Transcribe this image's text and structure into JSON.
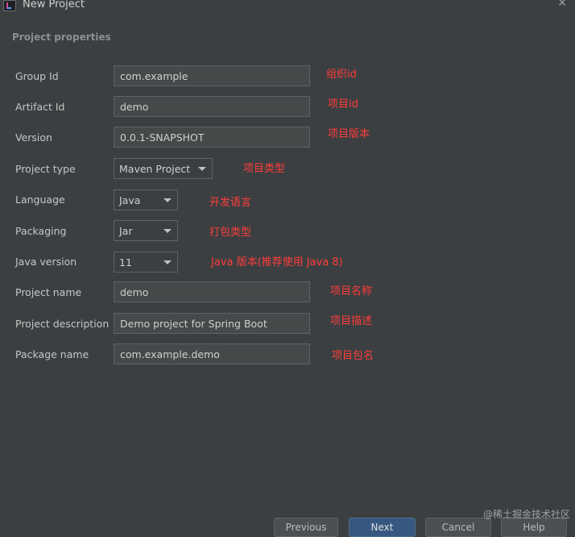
{
  "window": {
    "title": "New Project"
  },
  "section_title": "Project properties",
  "fields": {
    "group_id": {
      "label": "Group Id",
      "value": "com.example",
      "note": "组织id"
    },
    "artifact_id": {
      "label": "Artifact Id",
      "value": "demo",
      "note": "项目id"
    },
    "version": {
      "label": "Version",
      "value": "0.0.1-SNAPSHOT",
      "note": "项目版本"
    },
    "project_type": {
      "label": "Project type",
      "value": "Maven Project",
      "note": "项目类型"
    },
    "language": {
      "label": "Language",
      "value": "Java",
      "note": "开发语言"
    },
    "packaging": {
      "label": "Packaging",
      "value": "Jar",
      "note": "打包类型"
    },
    "java_version": {
      "label": "Java version",
      "value": "11",
      "note": "Java 版本(推荐使用 Java 8)"
    },
    "project_name": {
      "label": "Project name",
      "value": "demo",
      "note": "项目名称"
    },
    "project_description": {
      "label": "Project description",
      "value": "Demo project for Spring Boot",
      "note": "项目描述"
    },
    "package_name": {
      "label": "Package name",
      "value": "com.example.demo",
      "note": "项目包名"
    }
  },
  "buttons": {
    "previous": "Previous",
    "next": "Next",
    "cancel": "Cancel",
    "help": "Help"
  },
  "watermark": "@稀土掘金技术社区",
  "colors": {
    "background": "#3c3f41",
    "annotation": "#ff3c3c",
    "primary_button": "#365880"
  }
}
